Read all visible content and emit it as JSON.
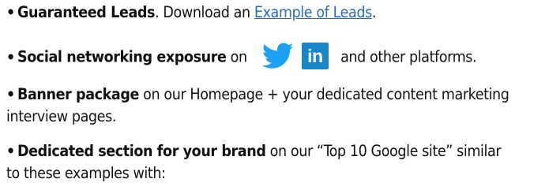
{
  "items": [
    {
      "bullet": "•",
      "bold": "Guaranteed Leads",
      "text": ". Download an ",
      "link": "Example of Leads",
      "tail": "."
    },
    {
      "bullet": "•",
      "bold": "Social networking exposure",
      "text": " on",
      "social_icons": [
        "twitter-bird-icon",
        "linkedin-icon"
      ],
      "linkedin_text": "in",
      "tail": "and other platforms."
    },
    {
      "bullet": "•",
      "bold": "Banner package",
      "text": " on our Homepage + your dedicated content marketing",
      "line2": "interview pages."
    },
    {
      "bullet": "•",
      "bold": "Dedicated section for your brand",
      "text": " on our “Top 10 Google site” similar",
      "line2": "to these examples with:"
    }
  ],
  "colors": {
    "text": "#111111",
    "link": "#2a6db7",
    "twitter": "#1da1f2",
    "linkedin": "#1a86c8"
  }
}
